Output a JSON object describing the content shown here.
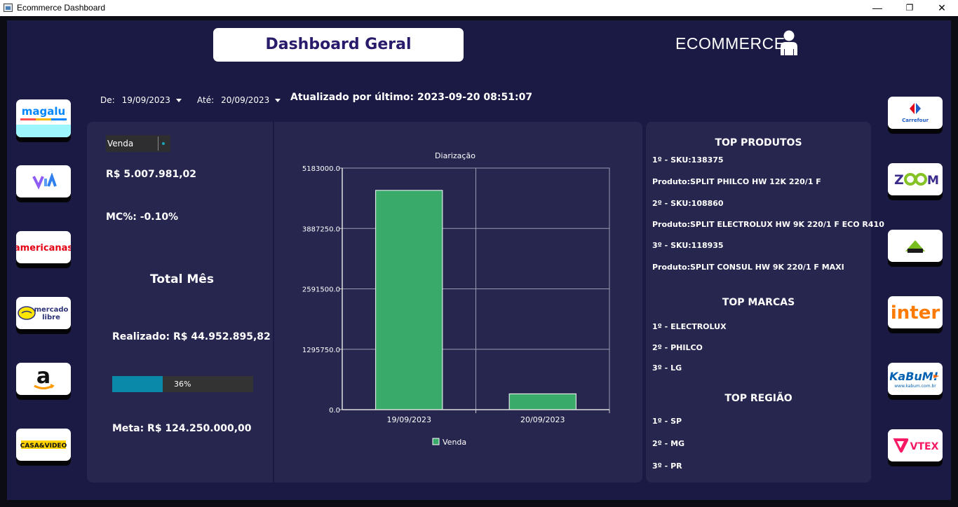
{
  "window": {
    "title": "Ecommerce Dashboard",
    "minimize": "—",
    "maximize": "❐",
    "close": "✕"
  },
  "header": {
    "title": "Dashboard Geral",
    "brand": "ECOMMERCE"
  },
  "filters": {
    "from_label": "De:",
    "from_value": "19/09/2023",
    "to_label": "Até:",
    "to_value": "20/09/2023",
    "updated": "Atualizado por último: 2023-09-20 08:51:07"
  },
  "left_logos": [
    "magalu",
    "via",
    "americanas",
    "mercado libre",
    "amazon",
    "CASA&VIDEO"
  ],
  "right_logos": [
    "Carrefour",
    "ZOOM",
    "Leroy Merlin",
    "inter",
    "KaBuM!",
    "VTEX"
  ],
  "summary": {
    "select_value": "Venda",
    "value": "R$ 5.007.981,02",
    "mc": "MC%: -0.10%",
    "month_title": "Total Mês",
    "realizado": "Realizado: R$ 44.952.895,82",
    "progress": 0.36,
    "progress_label": "36%",
    "meta": "Meta: R$ 124.250.000,00"
  },
  "chart_data": {
    "type": "bar",
    "title": "Diarização",
    "categories": [
      "19/09/2023",
      "20/09/2023"
    ],
    "series": [
      {
        "name": "Venda",
        "values": [
          4705000,
          340000
        ],
        "color": "#3aaa6b"
      }
    ],
    "ylim": [
      0,
      5183000
    ],
    "yticks": [
      "0.0",
      "1295750.0",
      "2591500.0",
      "3887250.0",
      "5183000.0"
    ],
    "grid": true,
    "legend": "bottom"
  },
  "top": {
    "produtos_title": "TOP PRODUTOS",
    "produtos": [
      "1º - SKU:138375",
      "Produto:SPLIT PHILCO HW 12K 220/1 F",
      "2º - SKU:108860",
      "Produto:SPLIT ELECTROLUX HW 9K 220/1 F ECO R410",
      "3º - SKU:118935",
      "Produto:SPLIT CONSUL HW 9K 220/1 F MAXI"
    ],
    "marcas_title": "TOP MARCAS",
    "marcas": [
      "1º - ELECTROLUX",
      "2º - PHILCO",
      "3º - LG"
    ],
    "regiao_title": "TOP REGIÃO",
    "regiao": [
      "1º - SP",
      "2º - MG",
      "3º - PR"
    ]
  }
}
